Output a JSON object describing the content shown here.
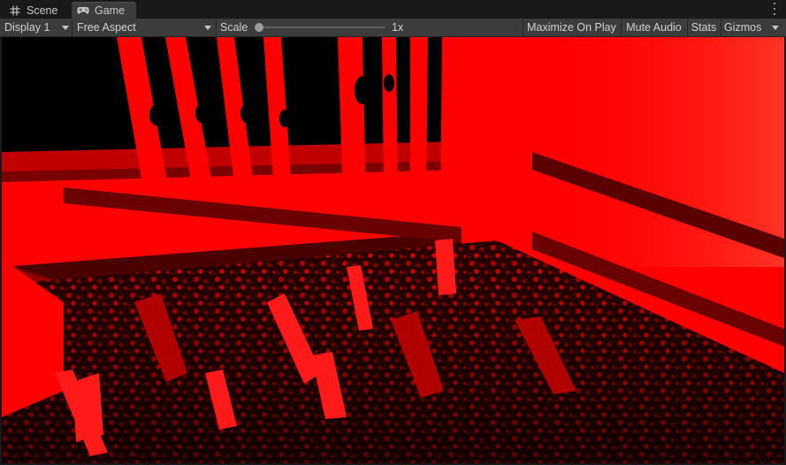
{
  "tabs": [
    {
      "label": "Scene",
      "icon": "grid-icon",
      "active": false
    },
    {
      "label": "Game",
      "icon": "gamepad-icon",
      "active": true
    }
  ],
  "toolbar": {
    "display": "Display 1",
    "aspect": "Free Aspect",
    "scale_label": "Scale",
    "scale_value": "1x",
    "scale_slider_level": 0,
    "maximize": "Maximize On Play",
    "mute": "Mute Audio",
    "stats": "Stats",
    "gizmos": "Gizmos"
  },
  "colors": {
    "viewport_tint": "#ff0000",
    "viewport_shadow": "#000000",
    "panel": "#3c3c3c",
    "tabbar": "#191919"
  }
}
